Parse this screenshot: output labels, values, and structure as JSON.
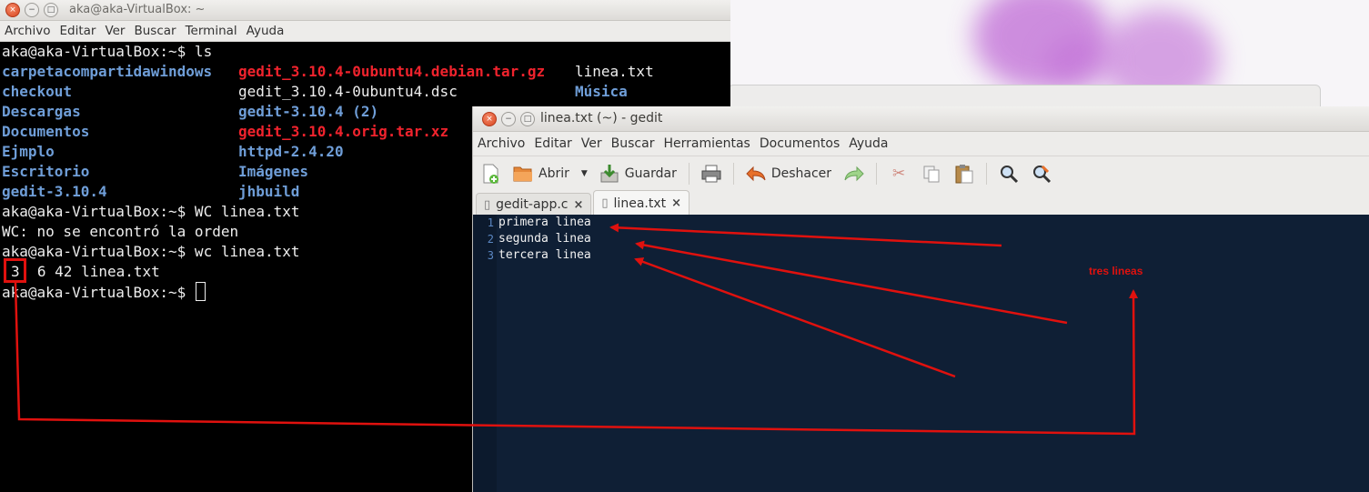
{
  "terminal": {
    "title": "aka@aka-VirtualBox: ~",
    "menu": [
      "Archivo",
      "Editar",
      "Ver",
      "Buscar",
      "Terminal",
      "Ayuda"
    ],
    "prompt": "aka@aka-VirtualBox:~$",
    "cmd1": " ls",
    "ls": {
      "col1": [
        "carpetacompartidawindows",
        "checkout",
        "Descargas",
        "Documentos",
        "Ejmplo",
        "Escritorio",
        "gedit-3.10.4"
      ],
      "col2": [
        "gedit_3.10.4-0ubuntu4.debian.tar.gz",
        "gedit_3.10.4-0ubuntu4.dsc",
        "gedit-3.10.4 (2)",
        "gedit_3.10.4.orig.tar.xz",
        "httpd-2.4.20",
        "Imágenes",
        "jhbuild"
      ],
      "col3": [
        "linea.txt",
        "Música"
      ]
    },
    "cmd2": " WC linea.txt",
    "error": "WC: no se encontró la orden",
    "cmd3": " wc linea.txt",
    "wc_count": "3",
    "wc_rest": "  6 42 linea.txt"
  },
  "gedit": {
    "title": "linea.txt (~) - gedit",
    "menu": [
      "Archivo",
      "Editar",
      "Ver",
      "Buscar",
      "Herramientas",
      "Documentos",
      "Ayuda"
    ],
    "toolbar": {
      "open": "Abrir",
      "save": "Guardar",
      "undo": "Deshacer"
    },
    "tabs": [
      {
        "label": "gedit-app.c"
      },
      {
        "label": "linea.txt"
      }
    ],
    "line_numbers": [
      "1",
      "2",
      "3"
    ],
    "lines": [
      "primera linea",
      "segunda linea",
      "tercera linea"
    ]
  },
  "annotation": {
    "label": "tres lineas",
    "color": "#e0110e"
  },
  "colors": {
    "dir": "#6f9ed8",
    "archive": "#f0232d",
    "editor_bg": "#0f1f35"
  }
}
